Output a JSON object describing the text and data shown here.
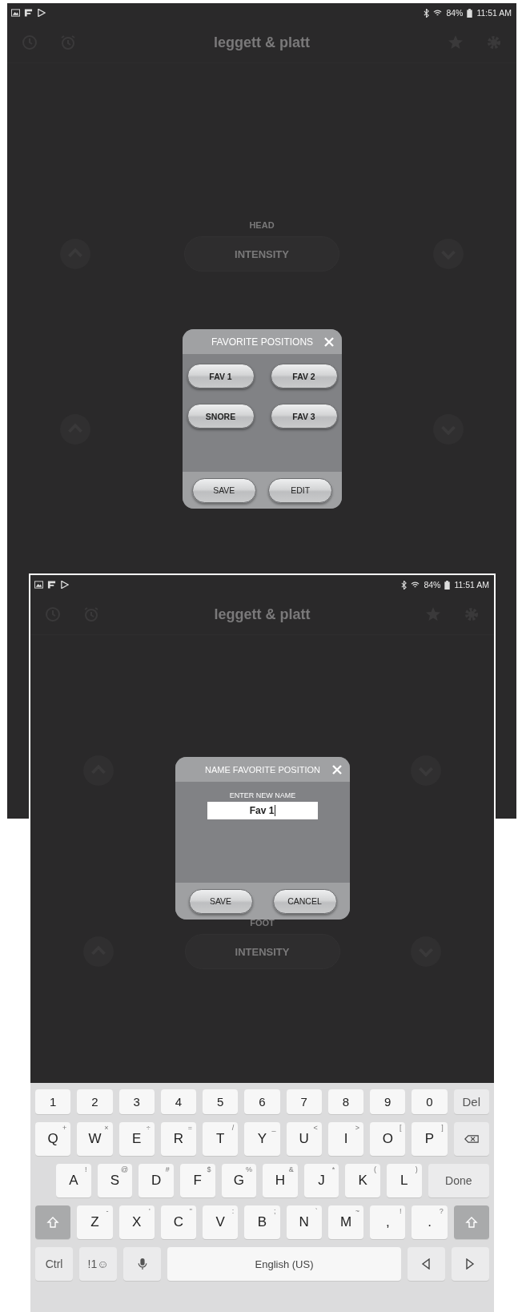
{
  "screenshots": [
    {
      "status_bar": {
        "battery": "84%",
        "time": "11:51 AM"
      },
      "app_title": "leggett & platt",
      "sections": [
        {
          "kind": "control",
          "label": "HEAD",
          "pill": "INTENSITY"
        },
        {
          "kind": "arrows"
        }
      ],
      "dialog": {
        "kind": "favorites",
        "title": "FAVORITE POSITIONS",
        "buttons": [
          "FAV 1",
          "FAV 2",
          "SNORE",
          "FAV 3"
        ],
        "footer_buttons": [
          "SAVE",
          "EDIT"
        ]
      }
    },
    {
      "status_bar": {
        "battery": "84%",
        "time": "11:51 AM"
      },
      "app_title": "leggett & platt",
      "sections": [
        {
          "kind": "arrows"
        },
        {
          "kind": "control",
          "label": "FOOT",
          "pill": "INTENSITY"
        }
      ],
      "dialog": {
        "kind": "name",
        "title": "NAME FAVORITE POSITION",
        "prompt": "ENTER NEW NAME",
        "value": "Fav 1",
        "footer_buttons": [
          "SAVE",
          "CANCEL"
        ]
      },
      "keyboard": {
        "rows": [
          {
            "keys": [
              {
                "kind": "char",
                "label": "1"
              },
              {
                "kind": "char",
                "label": "2"
              },
              {
                "kind": "char",
                "label": "3"
              },
              {
                "kind": "char",
                "label": "4"
              },
              {
                "kind": "char",
                "label": "5"
              },
              {
                "kind": "char",
                "label": "6"
              },
              {
                "kind": "char",
                "label": "7"
              },
              {
                "kind": "char",
                "label": "8"
              },
              {
                "kind": "char",
                "label": "9"
              },
              {
                "kind": "char",
                "label": "0"
              },
              {
                "kind": "function",
                "label": "Del"
              }
            ]
          },
          {
            "keys": [
              {
                "kind": "char",
                "label": "Q",
                "hint": "+"
              },
              {
                "kind": "char",
                "label": "W",
                "hint": "×"
              },
              {
                "kind": "char",
                "label": "E",
                "hint": "÷"
              },
              {
                "kind": "char",
                "label": "R",
                "hint": "="
              },
              {
                "kind": "char",
                "label": "T",
                "hint": "/"
              },
              {
                "kind": "char",
                "label": "Y",
                "hint": "_"
              },
              {
                "kind": "char",
                "label": "U",
                "hint": "<"
              },
              {
                "kind": "char",
                "label": "I",
                "hint": ">"
              },
              {
                "kind": "char",
                "label": "O",
                "hint": "["
              },
              {
                "kind": "char",
                "label": "P",
                "hint": "]"
              },
              {
                "kind": "backspace"
              }
            ]
          },
          {
            "keys": [
              {
                "kind": "char",
                "label": "A",
                "hint": "!"
              },
              {
                "kind": "char",
                "label": "S",
                "hint": "@"
              },
              {
                "kind": "char",
                "label": "D",
                "hint": "#"
              },
              {
                "kind": "char",
                "label": "F",
                "hint": "$"
              },
              {
                "kind": "char",
                "label": "G",
                "hint": "%"
              },
              {
                "kind": "char",
                "label": "H",
                "hint": "&"
              },
              {
                "kind": "char",
                "label": "J",
                "hint": "*"
              },
              {
                "kind": "char",
                "label": "K",
                "hint": "("
              },
              {
                "kind": "char",
                "label": "L",
                "hint": ")"
              },
              {
                "kind": "wide",
                "label": "Done"
              }
            ]
          },
          {
            "keys": [
              {
                "kind": "shift"
              },
              {
                "kind": "char",
                "label": "Z",
                "hint": "-"
              },
              {
                "kind": "char",
                "label": "X",
                "hint": "'"
              },
              {
                "kind": "char",
                "label": "C",
                "hint": "\""
              },
              {
                "kind": "char",
                "label": "V",
                "hint": ":"
              },
              {
                "kind": "char",
                "label": "B",
                "hint": ";"
              },
              {
                "kind": "char",
                "label": "N",
                "hint": "`"
              },
              {
                "kind": "char",
                "label": "M",
                "hint": "~"
              },
              {
                "kind": "char",
                "label": ",",
                "hint": "!"
              },
              {
                "kind": "char",
                "label": ".",
                "hint": "?"
              },
              {
                "kind": "shift"
              }
            ]
          },
          {
            "keys": [
              {
                "kind": "function",
                "label": "Ctrl"
              },
              {
                "kind": "function",
                "label": "!1☺"
              },
              {
                "kind": "mic"
              },
              {
                "kind": "space",
                "label": "English (US)"
              },
              {
                "kind": "left"
              },
              {
                "kind": "right"
              }
            ]
          }
        ]
      }
    }
  ]
}
